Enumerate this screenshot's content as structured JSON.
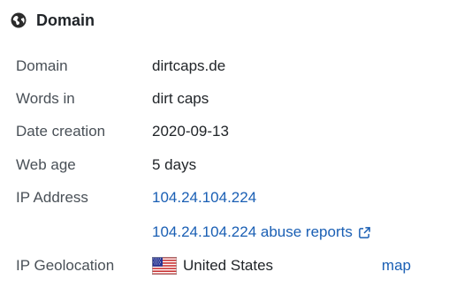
{
  "header": {
    "title": "Domain",
    "icon": "globe-icon"
  },
  "rows": {
    "domain": {
      "label": "Domain",
      "value": "dirtcaps.de"
    },
    "words": {
      "label": "Words in",
      "value": "dirt caps"
    },
    "created": {
      "label": "Date creation",
      "value": "2020-09-13"
    },
    "age": {
      "label": "Web age",
      "value": "5 days"
    },
    "ip": {
      "label": "IP Address",
      "value": "104.24.104.224"
    },
    "abuse": {
      "value": "104.24.104.224 abuse reports",
      "icon": "external-link-icon"
    },
    "geo": {
      "label": "IP Geolocation",
      "value": "United States",
      "flag": "us-flag-icon",
      "map_label": "map"
    }
  },
  "colors": {
    "link": "#1a5fb4",
    "label": "#495057",
    "text": "#212529"
  }
}
